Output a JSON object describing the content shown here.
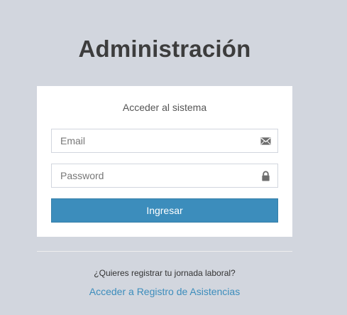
{
  "header": {
    "title": "Administración"
  },
  "login_box": {
    "subtitle": "Acceder al sistema",
    "email": {
      "placeholder": "Email",
      "value": "",
      "icon": "envelope-icon"
    },
    "password": {
      "placeholder": "Password",
      "value": "",
      "icon": "lock-icon"
    },
    "submit_label": "Ingresar"
  },
  "footer": {
    "question": "¿Quieres registrar tu jornada laboral?",
    "link_label": "Acceder a Registro de Asistencias"
  },
  "colors": {
    "background": "#d2d6de",
    "primary": "#3c8dbc",
    "card": "#ffffff",
    "title_text": "#3d3d3d"
  }
}
